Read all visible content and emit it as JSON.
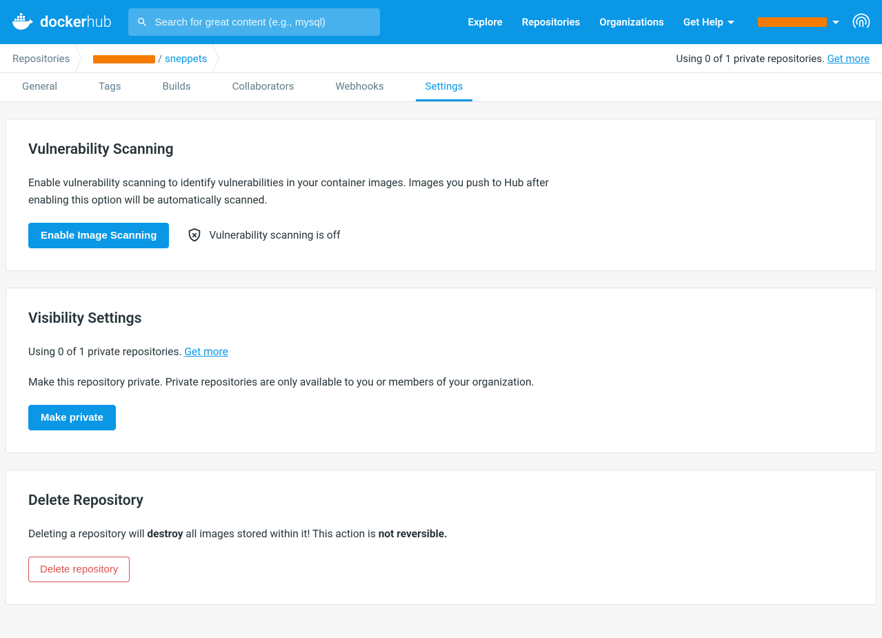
{
  "header": {
    "logo_main": "docker",
    "logo_sub": "hub",
    "search_placeholder": "Search for great content (e.g., mysql)",
    "nav": [
      "Explore",
      "Repositories",
      "Organizations",
      "Get Help"
    ]
  },
  "breadcrumb": {
    "root": "Repositories",
    "sep": "/ ",
    "repo": "sneppets",
    "usage_prefix": "Using 0 of 1 private repositories. ",
    "get_more": "Get more"
  },
  "tabs": [
    "General",
    "Tags",
    "Builds",
    "Collaborators",
    "Webhooks",
    "Settings"
  ],
  "active_tab": "Settings",
  "vuln": {
    "title": "Vulnerability Scanning",
    "desc": "Enable vulnerability scanning to identify vulnerabilities in your container images. Images you push to Hub after enabling this option will be automatically scanned.",
    "button": "Enable Image Scanning",
    "status": "Vulnerability scanning is off"
  },
  "visibility": {
    "title": "Visibility Settings",
    "usage_prefix": "Using 0 of 1 private repositories. ",
    "get_more": "Get more",
    "desc": "Make this repository private. Private repositories are only available to you or members of your organization.",
    "button": "Make private"
  },
  "delete": {
    "title": "Delete Repository",
    "desc_1": "Deleting a repository will ",
    "desc_bold1": "destroy",
    "desc_2": " all images stored within it! This action is ",
    "desc_bold2": "not reversible.",
    "button": "Delete repository"
  }
}
